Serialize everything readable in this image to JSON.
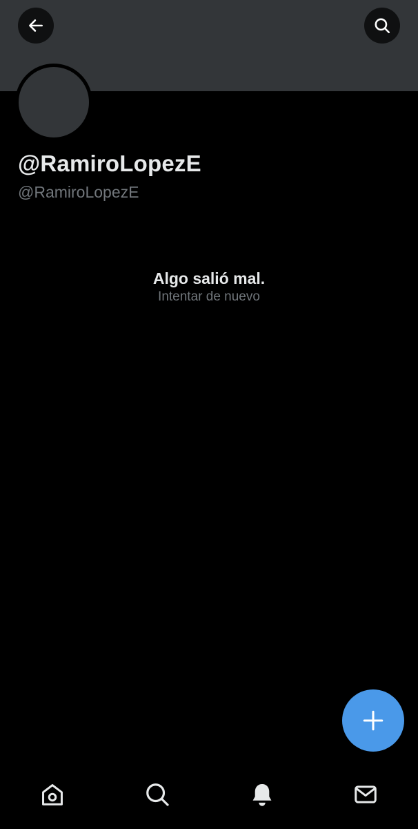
{
  "profile": {
    "display_name": "@RamiroLopezE",
    "handle": "@RamiroLopezE"
  },
  "error": {
    "title": "Algo salió mal.",
    "retry_label": "Intentar de nuevo"
  },
  "icons": {
    "back": "arrow-left-icon",
    "search": "search-icon",
    "compose": "plus-icon",
    "home": "home-icon",
    "explore": "search-icon",
    "notifications": "bell-icon",
    "messages": "envelope-icon"
  },
  "colors": {
    "background": "#000000",
    "banner": "#333639",
    "primary_text": "#e7e9ea",
    "secondary_text": "#71767b",
    "accent": "#4a99e9"
  }
}
